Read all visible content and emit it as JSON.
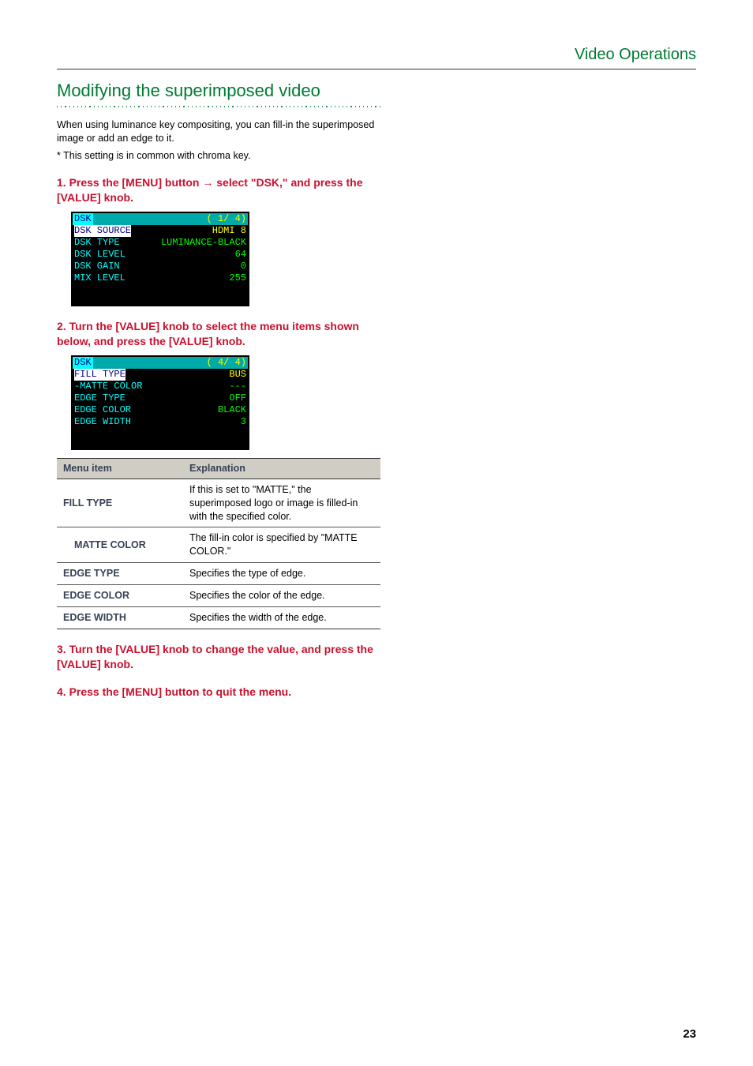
{
  "header": {
    "section": "Video Operations"
  },
  "section_title": "Modifying the superimposed video",
  "intro": "When using luminance key compositing, you can fill-in the superimposed image or add an edge to it.",
  "footnote": "*  This setting is in common with chroma key.",
  "steps": [
    {
      "num": "1.",
      "text_parts": [
        "Press the [MENU] button ",
        "→",
        " select \"DSK,\" and press the [VALUE] knob."
      ],
      "menu": {
        "title_left": "DSK",
        "title_right": "( 1/ 4)",
        "rows": [
          {
            "k": "DSK SOURCE",
            "v": "HDMI 8",
            "vc": "y",
            "sel": true
          },
          {
            "k": "DSK TYPE",
            "v": "LUMINANCE-BLACK",
            "vc": "g"
          },
          {
            "k": "DSK LEVEL",
            "v": "64",
            "vc": "g"
          },
          {
            "k": "DSK GAIN",
            "v": "0",
            "vc": "g"
          },
          {
            "k": "MIX LEVEL",
            "v": "255",
            "vc": "g"
          }
        ]
      }
    },
    {
      "num": "2.",
      "text_parts": [
        "Turn the [VALUE] knob to select the menu items shown below, and press the [VALUE] knob."
      ],
      "menu": {
        "title_left": "DSK",
        "title_right": "( 4/ 4)",
        "rows": [
          {
            "k": "FILL TYPE",
            "v": "BUS",
            "vc": "y",
            "sel": true
          },
          {
            "k": " -MATTE COLOR",
            "v": "---",
            "vc": "g"
          },
          {
            "k": "EDGE TYPE",
            "v": "OFF",
            "vc": "g"
          },
          {
            "k": "EDGE COLOR",
            "v": "BLACK",
            "vc": "g"
          },
          {
            "k": "EDGE WIDTH",
            "v": "3",
            "vc": "g"
          }
        ]
      },
      "table": {
        "head": [
          "Menu item",
          "Explanation"
        ],
        "rows": [
          {
            "mi": "FILL TYPE",
            "exp": "If this is set to \"MATTE,\" the superimposed logo or image is filled-in with the specified color.",
            "indent": false,
            "top": true
          },
          {
            "mi": "MATTE COLOR",
            "exp": "The fill-in color is specified by \"MATTE COLOR.\"",
            "indent": true
          },
          {
            "mi": "EDGE TYPE",
            "exp": "Specifies the type of edge."
          },
          {
            "mi": "EDGE COLOR",
            "exp": "Specifies the color of the edge."
          },
          {
            "mi": "EDGE WIDTH",
            "exp": "Specifies the width of the edge."
          }
        ]
      }
    },
    {
      "num": "3.",
      "text_parts": [
        "Turn the [VALUE] knob to change the value, and press the [VALUE] knob."
      ]
    },
    {
      "num": "4.",
      "text_parts": [
        "Press the [MENU] button to quit the menu."
      ]
    }
  ],
  "page_number": "23",
  "chart_data": {
    "type": "table",
    "title": "DSK menu items",
    "columns": [
      "Menu item",
      "Explanation"
    ],
    "rows": [
      [
        "FILL TYPE",
        "If this is set to \"MATTE,\" the superimposed logo or image is filled-in with the specified color."
      ],
      [
        "MATTE COLOR",
        "The fill-in color is specified by \"MATTE COLOR.\""
      ],
      [
        "EDGE TYPE",
        "Specifies the type of edge."
      ],
      [
        "EDGE COLOR",
        "Specifies the color of the edge."
      ],
      [
        "EDGE WIDTH",
        "Specifies the width of the edge."
      ]
    ]
  }
}
